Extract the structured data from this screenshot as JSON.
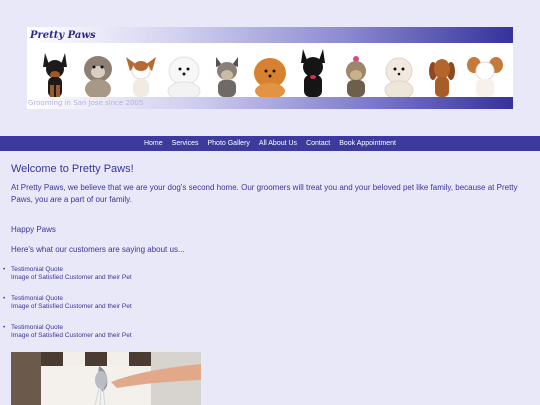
{
  "banner": {
    "brand_icon": "",
    "brand_name": "Pretty Paws",
    "tagline": "Grooming in San Jose since 2005",
    "dogs": [
      {
        "name": "min-pin-dog"
      },
      {
        "name": "shih-tzu-dog"
      },
      {
        "name": "chihuahua-dog"
      },
      {
        "name": "samoyed-dog"
      },
      {
        "name": "yorkie-dog"
      },
      {
        "name": "pomeranian-dog"
      },
      {
        "name": "scottish-terrier-dog"
      },
      {
        "name": "yorkie-bow-dog"
      },
      {
        "name": "maltese-dog"
      },
      {
        "name": "dachshund-dog"
      },
      {
        "name": "papillon-dog"
      }
    ]
  },
  "nav": {
    "items": [
      "Home",
      "Services",
      "Photo Gallery",
      "All About Us",
      "Contact",
      "Book Appointment"
    ]
  },
  "main": {
    "heading": "Welcome to Pretty Paws!",
    "intro_part1": "At Pretty Paws, we believe that we are your dog's second home. Our groomers will treat you and your beloved pet like family, because at Pretty Paws, you ",
    "intro_em": "are",
    "intro_part2": " a part of our family.",
    "happy_paws": "Happy Paws",
    "testimonial_intro": "Here's what our customers are saying about us...",
    "testimonials": [
      {
        "quote": "Testimonial Quote",
        "caption": "Image of Satisfied Customer and their Pet"
      },
      {
        "quote": "Testimonial Quote",
        "caption": "Image of Satisfied Customer and their Pet"
      },
      {
        "quote": "Testimonial Quote",
        "caption": "Image of Satisfied Customer and their Pet"
      }
    ]
  },
  "colors": {
    "background": "#e9e8f8",
    "nav": "#3d3a9e",
    "text": "#3a3699"
  }
}
